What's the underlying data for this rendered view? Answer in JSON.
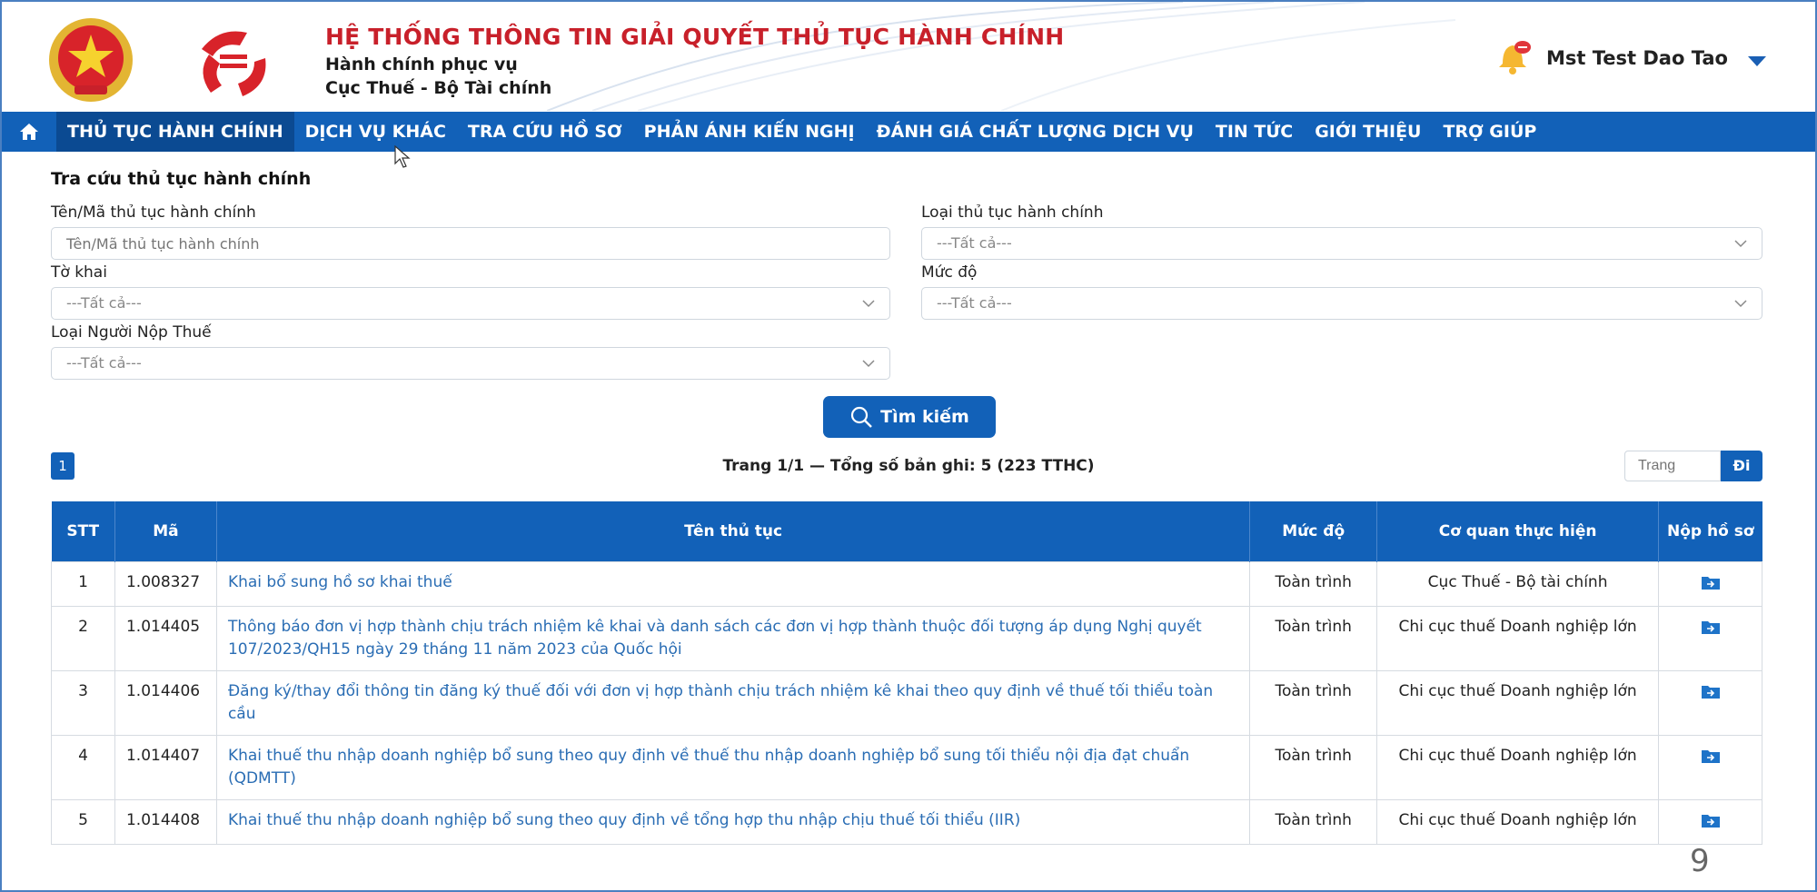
{
  "header": {
    "title": "HỆ THỐNG THÔNG TIN GIẢI QUYẾT THỦ TỤC HÀNH CHÍNH",
    "subtitle1": "Hành chính phục vụ",
    "subtitle2": "Cục Thuế - Bộ Tài chính",
    "user_name": "Mst Test Dao Tao"
  },
  "nav": {
    "items": [
      {
        "label": "THỦ TỤC HÀNH CHÍNH",
        "active": true
      },
      {
        "label": "DỊCH VỤ KHÁC"
      },
      {
        "label": "TRA CỨU HỒ SƠ"
      },
      {
        "label": "PHẢN ÁNH KIẾN NGHỊ"
      },
      {
        "label": "ĐÁNH GIÁ CHẤT LƯỢNG DỊCH VỤ"
      },
      {
        "label": "TIN TỨC"
      },
      {
        "label": "GIỚI THIỆU"
      },
      {
        "label": "TRỢ GIÚP"
      }
    ]
  },
  "search": {
    "title": "Tra cứu thủ tục hành chính",
    "name_label": "Tên/Mã thủ tục hành chính",
    "name_placeholder": "Tên/Mã thủ tục hành chính",
    "type_label": "Loại thủ tục hành chính",
    "type_value": "---Tất cả---",
    "form_label": "Tờ khai",
    "form_value": "---Tất cả---",
    "level_label": "Mức độ",
    "level_value": "---Tất cả---",
    "payer_label": "Loại Người Nộp Thuế",
    "payer_value": "---Tất cả---",
    "button_label": "Tìm kiếm"
  },
  "pagination": {
    "current_page": "1",
    "info": "Trang 1/1 — Tổng số bản ghi: 5 (223 TTHC)",
    "page_placeholder": "Trang",
    "go_label": "Đi"
  },
  "table": {
    "headers": {
      "stt": "STT",
      "ma": "Mã",
      "ten": "Tên thủ tục",
      "muc": "Mức độ",
      "coquan": "Cơ quan thực hiện",
      "nop": "Nộp hồ sơ"
    },
    "rows": [
      {
        "stt": "1",
        "ma": "1.008327",
        "ten": "Khai bổ sung hồ sơ khai thuế",
        "muc": "Toàn trình",
        "coquan": "Cục Thuế - Bộ tài chính"
      },
      {
        "stt": "2",
        "ma": "1.014405",
        "ten": "Thông báo đơn vị hợp thành chịu trách nhiệm kê khai và danh sách các đơn vị hợp thành thuộc đối tượng áp dụng Nghị quyết 107/2023/QH15 ngày 29 tháng 11 năm 2023 của Quốc hội",
        "muc": "Toàn trình",
        "coquan": "Chi cục thuế Doanh nghiệp lớn"
      },
      {
        "stt": "3",
        "ma": "1.014406",
        "ten": "Đăng ký/thay đổi thông tin đăng ký thuế đối với đơn vị hợp thành chịu trách nhiệm kê khai theo quy định về thuế tối thiểu toàn cầu",
        "muc": "Toàn trình",
        "coquan": "Chi cục thuế Doanh nghiệp lớn"
      },
      {
        "stt": "4",
        "ma": "1.014407",
        "ten": "Khai thuế thu nhập doanh nghiệp bổ sung theo quy định về thuế thu nhập doanh nghiệp bổ sung tối thiểu nội địa đạt chuẩn (QDMTT)",
        "muc": "Toàn trình",
        "coquan": "Chi cục thuế Doanh nghiệp lớn"
      },
      {
        "stt": "5",
        "ma": "1.014408",
        "ten": "Khai thuế thu nhập doanh nghiệp bổ sung theo quy định về tổng hợp thu nhập chịu thuế tối thiểu (IIR)",
        "muc": "Toàn trình",
        "coquan": "Chi cục thuế Doanh nghiệp lớn"
      }
    ]
  },
  "slide_number": "9",
  "colors": {
    "primary": "#1261b8",
    "title_red": "#c8202a",
    "link": "#2a6db4"
  }
}
